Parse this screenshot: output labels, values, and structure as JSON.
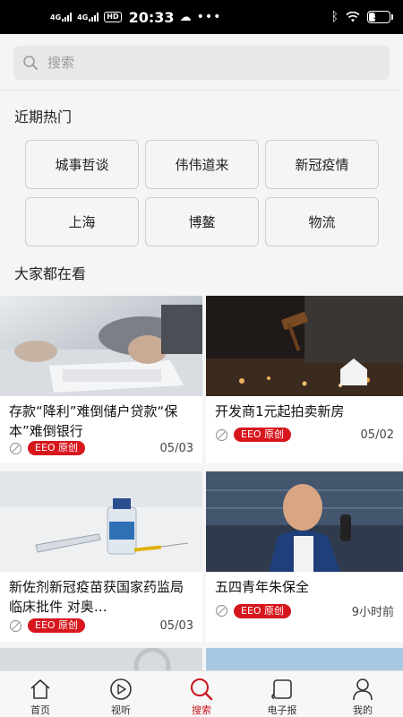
{
  "status_bar": {
    "signal1": "4G",
    "signal2": "4G",
    "hd": "HD",
    "time": "20:33",
    "dots": "•••",
    "battery": "34",
    "battery_level": 0.34
  },
  "search": {
    "placeholder": "搜索"
  },
  "hot": {
    "title": "近期热门",
    "tags": [
      "城事哲谈",
      "伟伟道来",
      "新冠疫情",
      "上海",
      "博鳌",
      "物流"
    ]
  },
  "popular": {
    "title": "大家都在看",
    "cards": [
      {
        "title": "存款“降利”难倒储户贷款“保本”难倒银行",
        "badge": "EEO 原创",
        "date": "05/03"
      },
      {
        "title": "开发商1元起拍卖新房",
        "badge": "EEO 原创",
        "date": "05/02"
      },
      {
        "title": "新佐剂新冠疫苗获国家药监局临床批件 对奥…",
        "badge": "EEO 原创",
        "date": "05/03"
      },
      {
        "title": "五四青年朱保全",
        "badge": "EEO 原创",
        "date": "9小时前"
      }
    ]
  },
  "tabbar": {
    "items": [
      {
        "label": "首页",
        "icon": "home-icon"
      },
      {
        "label": "视听",
        "icon": "play-icon"
      },
      {
        "label": "搜索",
        "icon": "search-icon"
      },
      {
        "label": "电子报",
        "icon": "newspaper-icon"
      },
      {
        "label": "我的",
        "icon": "profile-icon"
      }
    ],
    "active_index": 2,
    "active_color": "#c8161d"
  },
  "colors": {
    "badge": "#d7161e",
    "accent": "#c8161d"
  }
}
